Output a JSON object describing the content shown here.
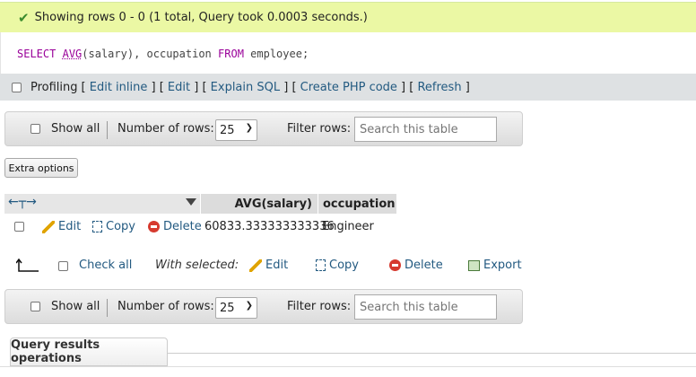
{
  "status": {
    "message": "Showing rows 0 - 0 (1 total, Query took 0.0003 seconds.)"
  },
  "sql": {
    "kw1": "SELECT",
    "fn": "AVG",
    "rest1": "(salary), occupation",
    "kw2": "FROM",
    "rest2": "employee;"
  },
  "profiling": {
    "label": "Profiling",
    "links": [
      "Edit inline",
      "Edit",
      "Explain SQL",
      "Create PHP code",
      "Refresh"
    ]
  },
  "navigation": {
    "show_all": "Show all",
    "rows_label": "Number of rows:",
    "rows_value": "25",
    "filter_label": "Filter rows:",
    "filter_placeholder": "Search this table"
  },
  "extra_options": "Extra options",
  "table": {
    "columns": [
      "AVG(salary)",
      "occupation"
    ],
    "rows": [
      {
        "edit": "Edit",
        "copy": "Copy",
        "delete": "Delete",
        "avg_salary": "60833.333333333336",
        "occupation": "Engineer"
      }
    ]
  },
  "bulk": {
    "check_all": "Check all",
    "with_selected": "With selected:",
    "edit": "Edit",
    "copy": "Copy",
    "delete": "Delete",
    "export": "Export"
  },
  "query_results_operations": "Query results operations"
}
